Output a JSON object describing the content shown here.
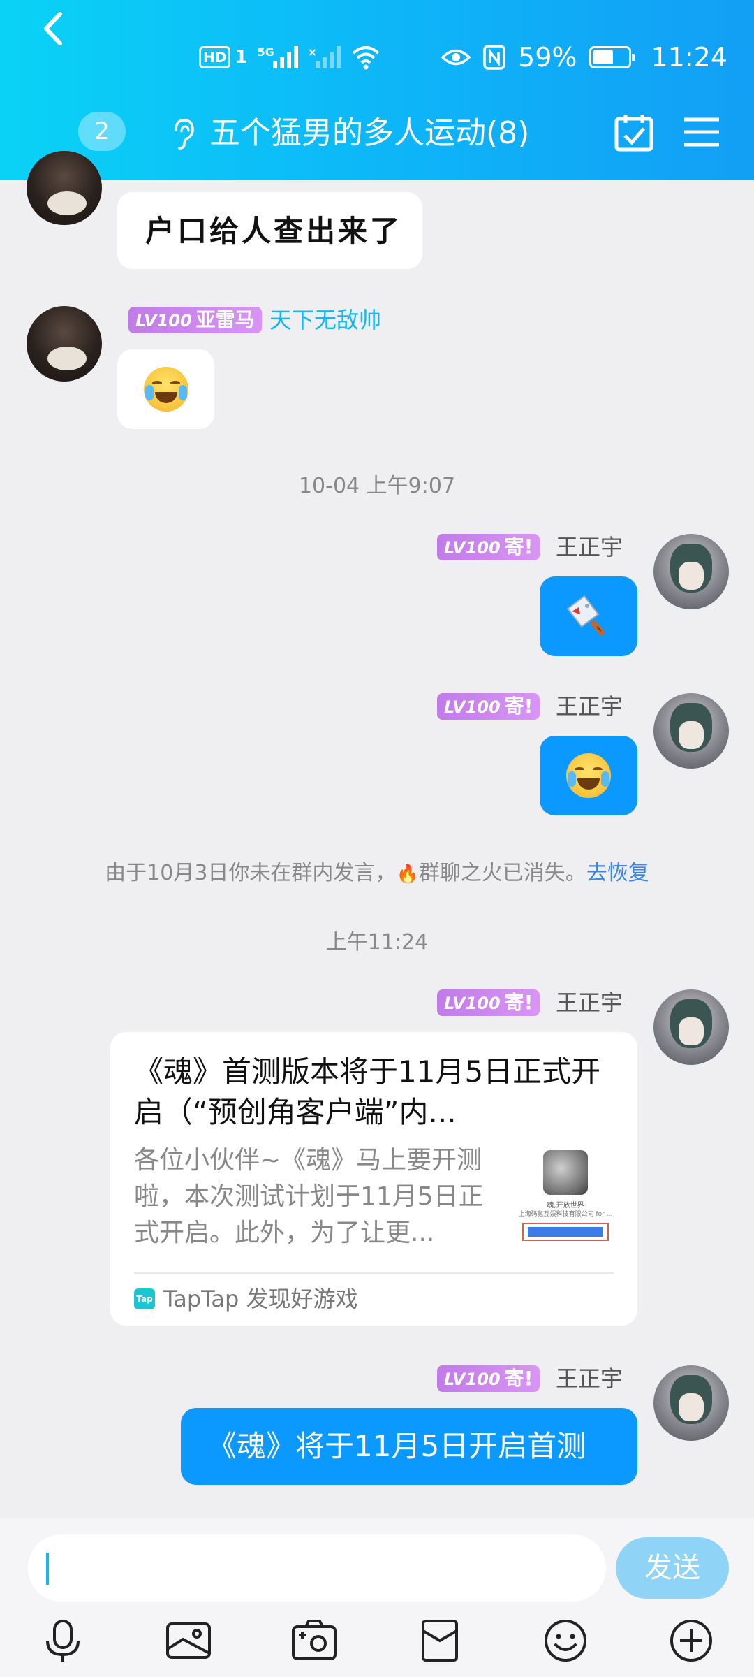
{
  "status_bar": {
    "hd": "HD",
    "sim": "1",
    "net": "5G",
    "battery_pct": "59%",
    "battery_level": 0.59,
    "time": "11:24"
  },
  "header": {
    "unread_count": "2",
    "title": "五个猛男的多人运动(8)",
    "icons": [
      "back-arrow-icon",
      "ear-icon",
      "calendar-check-icon",
      "menu-icon"
    ]
  },
  "messages": {
    "m1": {
      "text": "户口给人查出来了"
    },
    "m2": {
      "level": "LV100",
      "title": "亚雷马",
      "sender": "天下无敌帅",
      "content": "laughing-tears-emoji"
    },
    "time1": "10-04 上午9:07",
    "m3": {
      "level": "LV100",
      "title": "寄!",
      "sender": "王正宇",
      "content": "knife-emoji"
    },
    "m4": {
      "level": "LV100",
      "title": "寄!",
      "sender": "王正宇",
      "content": "laughing-tears-emoji"
    },
    "system": {
      "text": "由于10月3日你未在群内发言，",
      "fire": "🔥",
      "text2": "群聊之火已消失。",
      "link": "去恢复"
    },
    "time2": "上午11:24",
    "m5": {
      "level": "LV100",
      "title": "寄!",
      "sender": "王正宇",
      "card_title": "《魂》首测版本将于11月5日正式开启（“预创角客户端”内...",
      "card_desc": "各位小伙伴~《魂》马上要开测啦，本次测试计划于11月5日正式开启。此外，为了让更...",
      "thumb_line1": "魂,开放世界",
      "thumb_line2": "上海码氪互娱科技有限公司 for ...",
      "source_icon": "Tap",
      "source": "TapTap 发现好游戏"
    },
    "m6": {
      "level": "LV100",
      "title": "寄!",
      "sender": "王正宇",
      "text": "《魂》将于11月5日开启首测"
    }
  },
  "input": {
    "value": "",
    "send_label": "发送",
    "tools": [
      "microphone-icon",
      "image-icon",
      "camera-icon",
      "red-packet-icon",
      "emoji-icon",
      "plus-icon"
    ]
  }
}
